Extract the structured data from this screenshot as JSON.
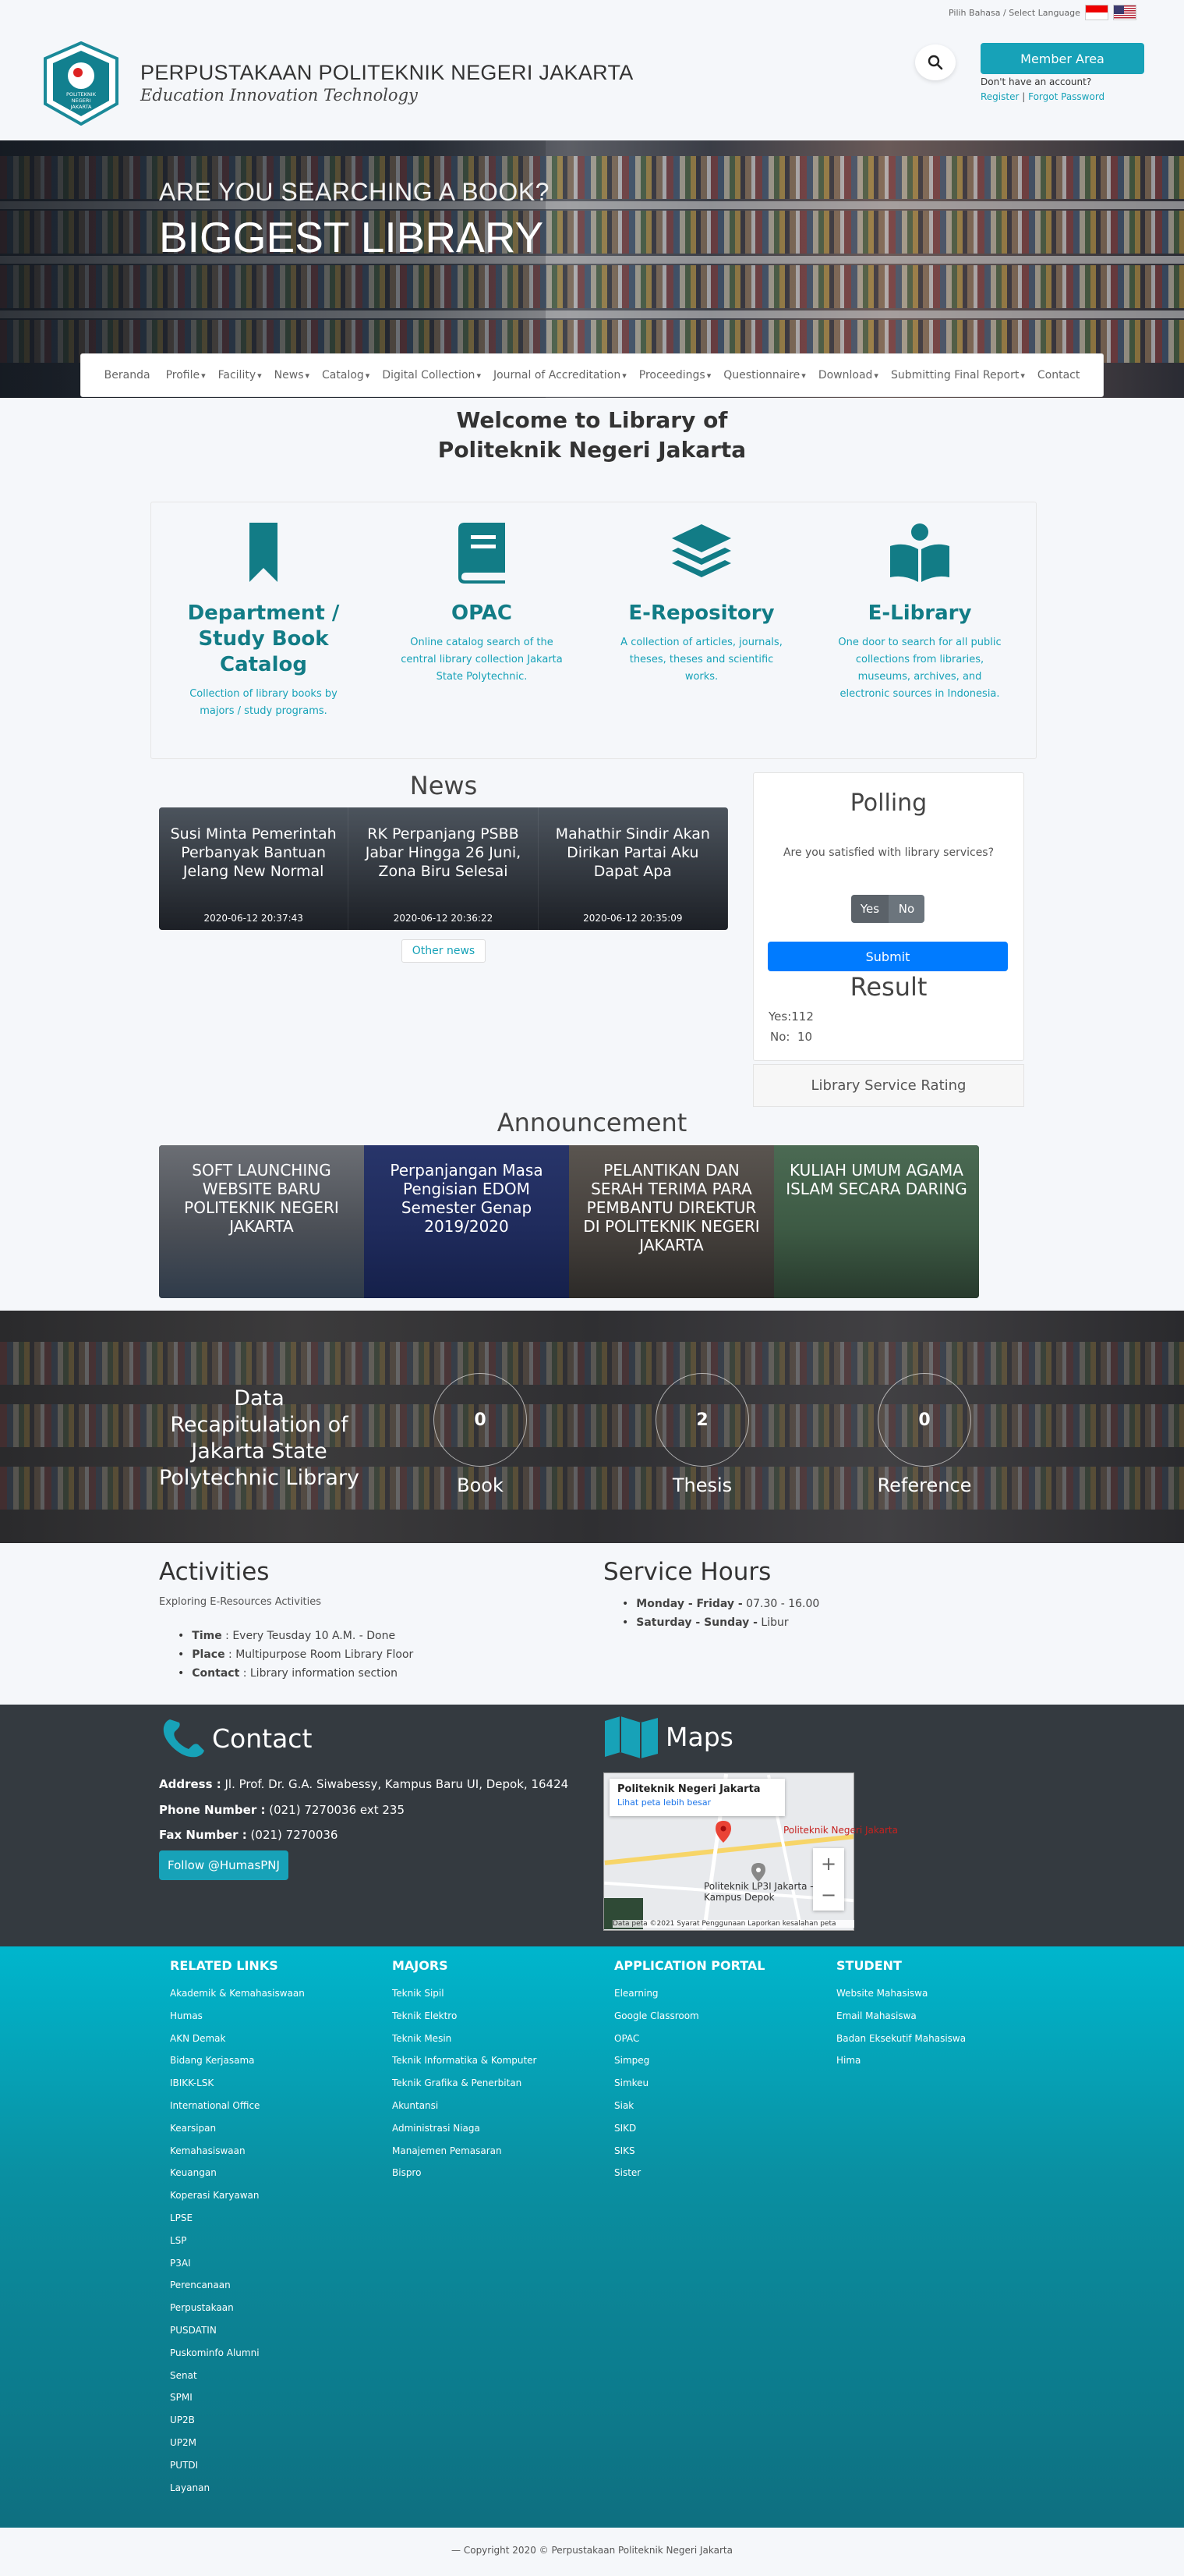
{
  "header": {
    "lang_label": "Pilih Bahasa / Select Language",
    "site_title": "PERPUSTAKAAN POLITEKNIK NEGERI JAKARTA",
    "tagline": "Education Innovation Technology",
    "logo_text": "POLITEKNIK NEGERI JAKARTA",
    "member_button": "Member Area",
    "no_account": "Don't have an account?",
    "register": "Register",
    "separator": "|",
    "forgot_password": "Forgot Password"
  },
  "hero": {
    "subtitle": "ARE YOU SEARCHING A BOOK?",
    "title": "BIGGEST LIBRARY"
  },
  "nav": [
    {
      "label": "Beranda",
      "dropdown": false
    },
    {
      "label": "Profile",
      "dropdown": true
    },
    {
      "label": "Facility",
      "dropdown": true
    },
    {
      "label": "News",
      "dropdown": true
    },
    {
      "label": "Catalog",
      "dropdown": true
    },
    {
      "label": "Digital Collection",
      "dropdown": true
    },
    {
      "label": "Journal of Accreditation",
      "dropdown": true
    },
    {
      "label": "Proceedings",
      "dropdown": true
    },
    {
      "label": "Questionnaire",
      "dropdown": true
    },
    {
      "label": "Download",
      "dropdown": true
    },
    {
      "label": "Submitting Final Report",
      "dropdown": true
    },
    {
      "label": "Contact",
      "dropdown": false
    }
  ],
  "welcome": {
    "line1": "Welcome to Library of",
    "line2": "Politeknik Negeri Jakarta"
  },
  "features": [
    {
      "icon": "bookmark-icon",
      "title": "Department / Study Book Catalog",
      "desc": "Collection of library books by majors / study programs."
    },
    {
      "icon": "book-icon",
      "title": "OPAC",
      "desc": "Online catalog search of the central library collection Jakarta State Polytechnic."
    },
    {
      "icon": "layers-icon",
      "title": "E-Repository",
      "desc": "A collection of articles, journals, theses, theses and scientific works."
    },
    {
      "icon": "reader-icon",
      "title": "E-Library",
      "desc": "One door to search for all public collections from libraries, museums, archives, and electronic sources in Indonesia."
    }
  ],
  "news": {
    "title": "News",
    "items": [
      {
        "title": "Susi Minta Pemerintah Perbanyak Bantuan Jelang New Normal",
        "date": "2020-06-12 20:37:43"
      },
      {
        "title": "RK Perpanjang PSBB Jabar Hingga 26 Juni, Zona Biru Selesai",
        "date": "2020-06-12 20:36:22"
      },
      {
        "title": "Mahathir Sindir Akan Dirikan Partai Aku Dapat Apa",
        "date": "2020-06-12 20:35:09"
      }
    ],
    "other_button": "Other news"
  },
  "polling": {
    "title": "Polling",
    "question": "Are you satisfied with library services?",
    "yes": "Yes",
    "no": "No",
    "submit": "Submit",
    "result_title": "Result",
    "result_yes": "Yes:112",
    "result_no": "No:  10",
    "rating": "Library Service Rating"
  },
  "announcement": {
    "title": "Announcement",
    "items": [
      "SOFT LAUNCHING WEBSITE BARU POLITEKNIK NEGERI JAKARTA",
      "Perpanjangan Masa Pengisian EDOM Semester Genap 2019/2020",
      "PELANTIKAN DAN SERAH TERIMA PARA PEMBANTU DIREKTUR DI POLITEKNIK NEGERI JAKARTA",
      "KULIAH UMUM AGAMA ISLAM SECARA DARING"
    ]
  },
  "stats": {
    "label": "Data Recapitulation of Jakarta State Polytechnic Library",
    "items": [
      {
        "value": "0",
        "label": "Book"
      },
      {
        "value": "2",
        "label": "Thesis"
      },
      {
        "value": "0",
        "label": "Reference"
      }
    ]
  },
  "activities": {
    "title": "Activities",
    "subtitle": "Exploring E-Resources Activities",
    "items": [
      {
        "key": "Time",
        "value": " : Every Teusday 10 A.M. - Done"
      },
      {
        "key": "Place",
        "value": " : Multipurpose Room Library Floor"
      },
      {
        "key": "Contact",
        "value": " : Library information section"
      }
    ]
  },
  "service_hours": {
    "title": "Service Hours",
    "items": [
      {
        "key": "Monday - Friday -",
        "value": " 07.30 - 16.00"
      },
      {
        "key": "Saturday - Sunday -",
        "value": " Libur"
      }
    ]
  },
  "contact": {
    "title": "Contact",
    "address_label": "Address :",
    "address": " Jl. Prof. Dr. G.A. Siwabessy, Kampus Baru UI, Depok, 16424",
    "phone_label": "Phone Number :",
    "phone": " (021) 7270036 ext 235",
    "fax_label": "Fax Number :",
    "fax": " (021) 7270036",
    "follow": "Follow @HumasPNJ"
  },
  "maps": {
    "title": "Maps",
    "place": "Politeknik Negeri Jakarta",
    "larger_map": "Lihat peta lebih besar",
    "pin_label": "Politeknik Negeri Jakarta",
    "poi": "Politeknik LP3I Jakarta - Kampus Depok",
    "footer": "Data peta ©2021   Syarat Penggunaan   Laporkan kesalahan peta",
    "zoom_in": "+",
    "zoom_out": "−"
  },
  "footer": {
    "columns": [
      {
        "heading": "RELATED LINKS",
        "items": [
          "Akademik & Kemahasiswaan",
          "Humas",
          "AKN Demak",
          "Bidang Kerjasama",
          "IBIKK-LSK",
          "International Office",
          "Kearsipan",
          "Kemahasiswaan",
          "Keuangan",
          "Koperasi Karyawan",
          "LPSE",
          "LSP",
          "P3AI",
          "Perencanaan",
          "Perpustakaan",
          "PUSDATIN",
          "Puskominfo Alumni",
          "Senat",
          "SPMI",
          "UP2B",
          "UP2M",
          "PUTDI",
          "Layanan"
        ]
      },
      {
        "heading": "MAJORS",
        "items": [
          "Teknik Sipil",
          "Teknik Elektro",
          "Teknik Mesin",
          "Teknik Informatika & Komputer",
          "Teknik Grafika & Penerbitan",
          "Akuntansi",
          "Administrasi Niaga",
          "Manajemen Pemasaran",
          "Bispro"
        ]
      },
      {
        "heading": "APPLICATION PORTAL",
        "items": [
          "Elearning",
          "Google Classroom",
          "OPAC",
          "Simpeg",
          "Simkeu",
          "Siak",
          "SIKD",
          "SIKS",
          "Sister"
        ]
      },
      {
        "heading": "STUDENT",
        "items": [
          "Website Mahasiswa",
          "Email Mahasiswa",
          "Badan Eksekutif Mahasiswa",
          "Hima"
        ]
      }
    ],
    "copyright": "— Copyright 2020 © Perpustakaan Politeknik Negeri Jakarta"
  },
  "colors": {
    "accent": "#17a2b8",
    "accent_dark": "#127c86",
    "primary": "#007bff",
    "footer_dark": "#343a40"
  }
}
